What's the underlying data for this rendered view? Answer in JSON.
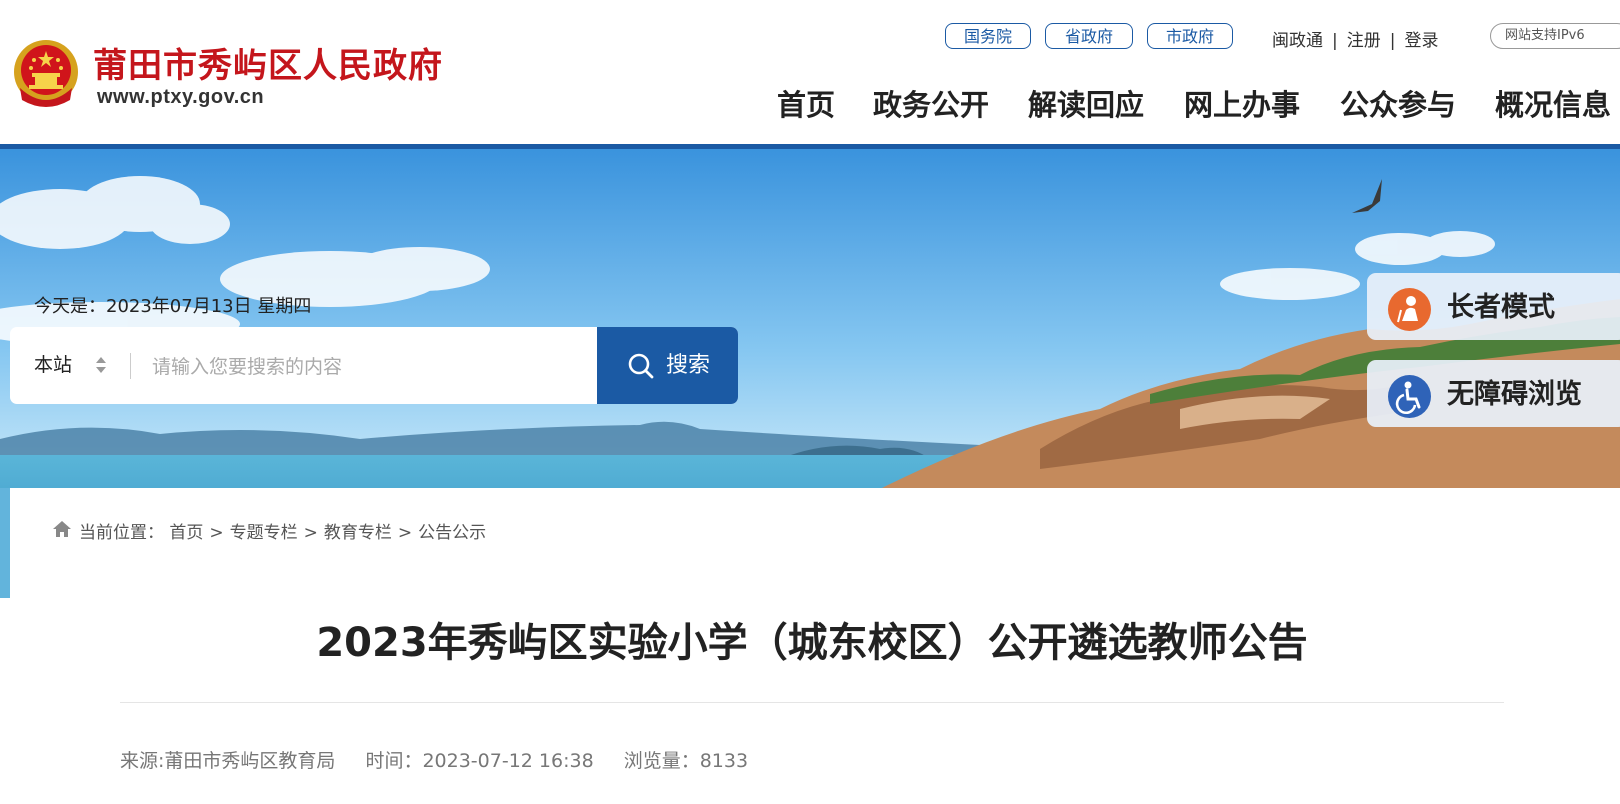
{
  "header": {
    "site_name": "莆田市秀屿区人民政府",
    "site_url": "www.ptxy.gov.cn",
    "gov_links": [
      "国务院",
      "省政府",
      "市政府"
    ],
    "top_links": [
      "闽政通",
      "注册",
      "登录"
    ],
    "support_text": "网站支持IPv6",
    "nav": [
      "首页",
      "政务公开",
      "解读回应",
      "网上办事",
      "公众参与",
      "概况信息"
    ]
  },
  "banner": {
    "date_label": "今天是：2023年07月13日 星期四",
    "search": {
      "scope": "本站",
      "placeholder": "请输入您要搜索的内容",
      "button_label": "搜索"
    },
    "side_buttons": [
      "长者模式",
      "无障碍浏览"
    ]
  },
  "breadcrumb": {
    "label": "当前位置：",
    "items": [
      "首页",
      "专题专栏",
      "教育专栏",
      "公告公示"
    ]
  },
  "article": {
    "title": "2023年秀屿区实验小学（城东校区）公开遴选教师公告",
    "source": "来源:莆田市秀屿区教育局",
    "time": "时间：2023-07-12 16:38",
    "views": "浏览量：8133"
  },
  "colors": {
    "brand_red": "#c4161c",
    "brand_blue": "#1b5aa4",
    "elder_orange": "#e8692f",
    "accessibility_blue": "#2f63b8"
  }
}
